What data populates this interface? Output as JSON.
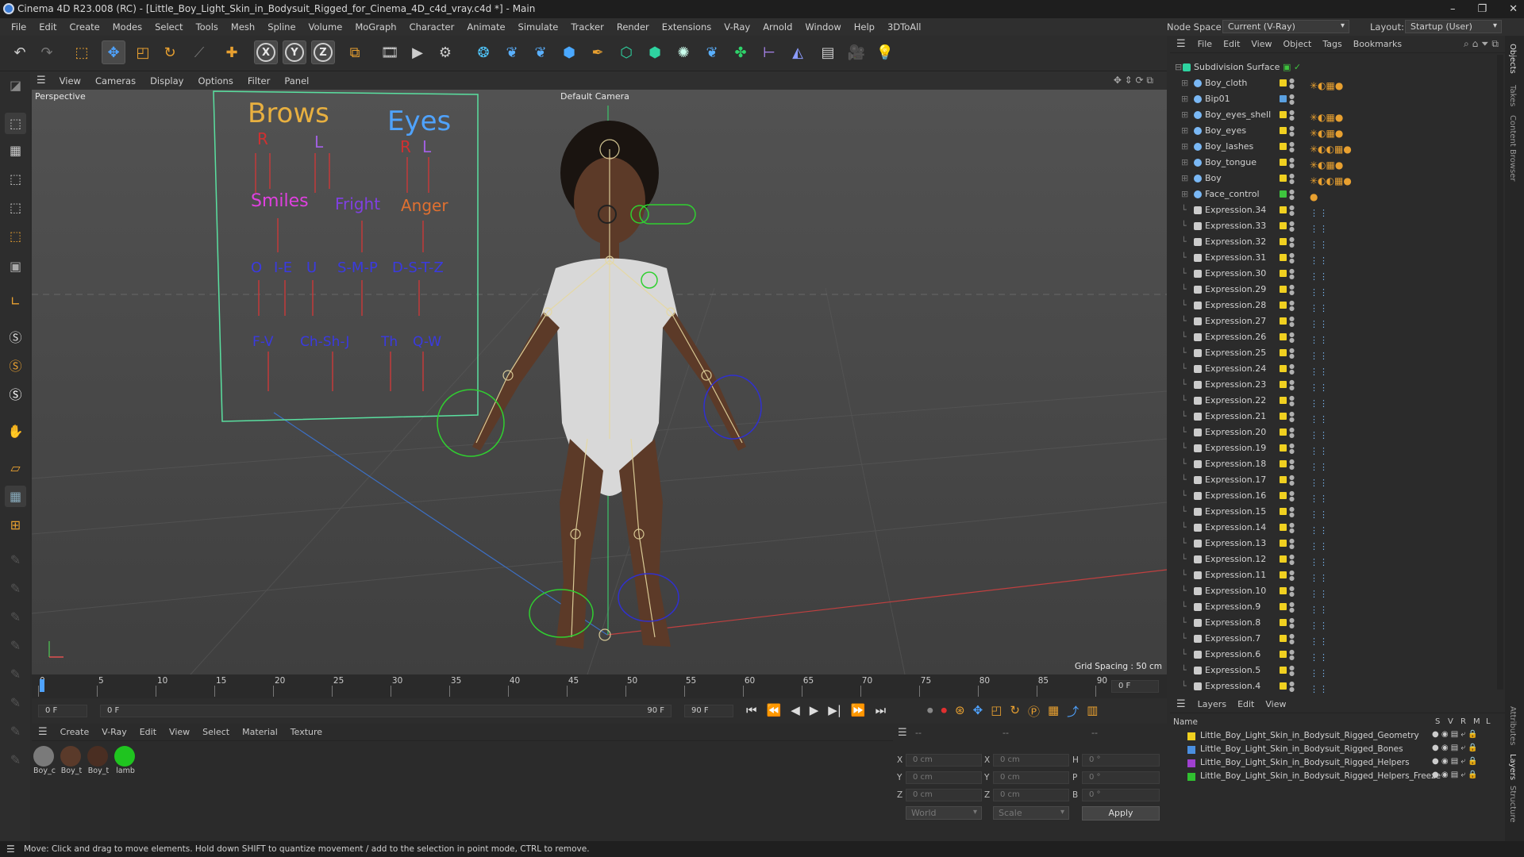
{
  "window": {
    "title": "Cinema 4D R23.008 (RC) - [Little_Boy_Light_Skin_in_Bodysuit_Rigged_for_Cinema_4D_c4d_vray.c4d *] - Main",
    "controls": [
      "–",
      "❐",
      "✕"
    ]
  },
  "menubar": [
    "File",
    "Edit",
    "Create",
    "Modes",
    "Select",
    "Tools",
    "Mesh",
    "Spline",
    "Volume",
    "MoGraph",
    "Character",
    "Animate",
    "Simulate",
    "Tracker",
    "Render",
    "Extensions",
    "V-Ray",
    "Arnold",
    "Window",
    "Help",
    "3DToAll"
  ],
  "node_space": {
    "label": "Node Space:",
    "value": "Current (V-Ray)"
  },
  "layout": {
    "label": "Layout:",
    "value": "Startup (User)"
  },
  "viewport_menu": [
    "View",
    "Cameras",
    "Display",
    "Options",
    "Filter",
    "Panel"
  ],
  "viewport": {
    "name": "Perspective",
    "camera": "Default Camera",
    "grid_spacing": "Grid Spacing : 50 cm",
    "rig_labels": {
      "brows": "Brows",
      "eyes": "Eyes",
      "r1": "R",
      "l1": "L",
      "r2": "R",
      "l2": "L",
      "smiles": "Smiles",
      "fright": "Fright",
      "anger": "Anger",
      "o": "O",
      "ie": "I-E",
      "u": "U",
      "smp": "S-M-P",
      "dstz": "D-S-T-Z",
      "fv": "F-V",
      "chshj": "Ch-Sh-J",
      "th": "Th",
      "qw": "Q-W"
    }
  },
  "timeline": {
    "ticks": [
      "0",
      "5",
      "10",
      "15",
      "20",
      "25",
      "30",
      "35",
      "40",
      "45",
      "50",
      "55",
      "60",
      "65",
      "70",
      "75",
      "80",
      "85",
      "90"
    ],
    "current_frame": "0 F"
  },
  "playbar": {
    "start": "0 F",
    "range_start": "0 F",
    "range_end": "90 F",
    "end": "90 F"
  },
  "material_manager": {
    "menu": [
      "Create",
      "V-Ray",
      "Edit",
      "View",
      "Select",
      "Material",
      "Texture"
    ],
    "materials": [
      {
        "label": "Boy_c",
        "color": "#7a7a7a"
      },
      {
        "label": "Boy_t",
        "color": "#5a3a2a"
      },
      {
        "label": "Boy_t",
        "color": "#4a2e22"
      },
      {
        "label": "lamb",
        "color": "#1fc41f"
      }
    ]
  },
  "attributes": {
    "header": "--",
    "rows": [
      {
        "a": "X",
        "av": "0 cm",
        "b": "X",
        "bv": "0 cm",
        "c": "H",
        "cv": "0 °"
      },
      {
        "a": "Y",
        "av": "0 cm",
        "b": "Y",
        "bv": "0 cm",
        "c": "P",
        "cv": "0 °"
      },
      {
        "a": "Z",
        "av": "0 cm",
        "b": "Z",
        "bv": "0 cm",
        "c": "B",
        "cv": "0 °"
      }
    ],
    "coord_mode": "World",
    "scale_mode": "Scale",
    "apply": "Apply"
  },
  "object_manager": {
    "menu": [
      "File",
      "Edit",
      "View",
      "Object",
      "Tags",
      "Bookmarks"
    ],
    "root": "Subdivision Surface",
    "objects": [
      {
        "name": "Boy_cloth",
        "color": "#f0d020",
        "tags": "✳◐▦●"
      },
      {
        "name": "Bip01",
        "color": "#5aa0e0",
        "tags": ""
      },
      {
        "name": "Boy_eyes_shell",
        "color": "#f0d020",
        "tags": "✳◐▦●"
      },
      {
        "name": "Boy_eyes",
        "color": "#f0d020",
        "tags": "✳◐▦●"
      },
      {
        "name": "Boy_lashes",
        "color": "#f0d020",
        "tags": "✳◐◐▦●"
      },
      {
        "name": "Boy_tongue",
        "color": "#f0d020",
        "tags": "✳◐▦●"
      },
      {
        "name": "Boy",
        "color": "#f0d020",
        "tags": "✳◐◐▦●"
      },
      {
        "name": "Face_control",
        "color": "#3ec43e",
        "tags": "●"
      },
      {
        "name": "Expression.34"
      },
      {
        "name": "Expression.33"
      },
      {
        "name": "Expression.32"
      },
      {
        "name": "Expression.31"
      },
      {
        "name": "Expression.30"
      },
      {
        "name": "Expression.29"
      },
      {
        "name": "Expression.28"
      },
      {
        "name": "Expression.27"
      },
      {
        "name": "Expression.26"
      },
      {
        "name": "Expression.25"
      },
      {
        "name": "Expression.24"
      },
      {
        "name": "Expression.23"
      },
      {
        "name": "Expression.22"
      },
      {
        "name": "Expression.21"
      },
      {
        "name": "Expression.20"
      },
      {
        "name": "Expression.19"
      },
      {
        "name": "Expression.18"
      },
      {
        "name": "Expression.17"
      },
      {
        "name": "Expression.16"
      },
      {
        "name": "Expression.15"
      },
      {
        "name": "Expression.14"
      },
      {
        "name": "Expression.13"
      },
      {
        "name": "Expression.12"
      },
      {
        "name": "Expression.11"
      },
      {
        "name": "Expression.10"
      },
      {
        "name": "Expression.9"
      },
      {
        "name": "Expression.8"
      },
      {
        "name": "Expression.7"
      },
      {
        "name": "Expression.6"
      },
      {
        "name": "Expression.5"
      },
      {
        "name": "Expression.4"
      }
    ],
    "expression_color": "#f0d020",
    "expression_tag": "⋮⋮"
  },
  "layers": {
    "menu": [
      "Layers",
      "Edit",
      "View"
    ],
    "columns": [
      "Name",
      "S",
      "V",
      "R",
      "M",
      "L"
    ],
    "items": [
      {
        "name": "Little_Boy_Light_Skin_in_Bodysuit_Rigged_Geometry",
        "color": "#f0d020"
      },
      {
        "name": "Little_Boy_Light_Skin_in_Bodysuit_Rigged_Bones",
        "color": "#4a8fe0"
      },
      {
        "name": "Little_Boy_Light_Skin_in_Bodysuit_Rigged_Helpers",
        "color": "#a040d0"
      },
      {
        "name": "Little_Boy_Light_Skin_in_Bodysuit_Rigged_Helpers_Freeze",
        "color": "#30c030"
      }
    ]
  },
  "right_tabs": [
    "Objects",
    "Takes",
    "Content Browser",
    "Attributes",
    "Layers",
    "Structure"
  ],
  "status": "Move: Click and drag to move elements. Hold down SHIFT to quantize movement / add to the selection in point mode, CTRL to remove."
}
